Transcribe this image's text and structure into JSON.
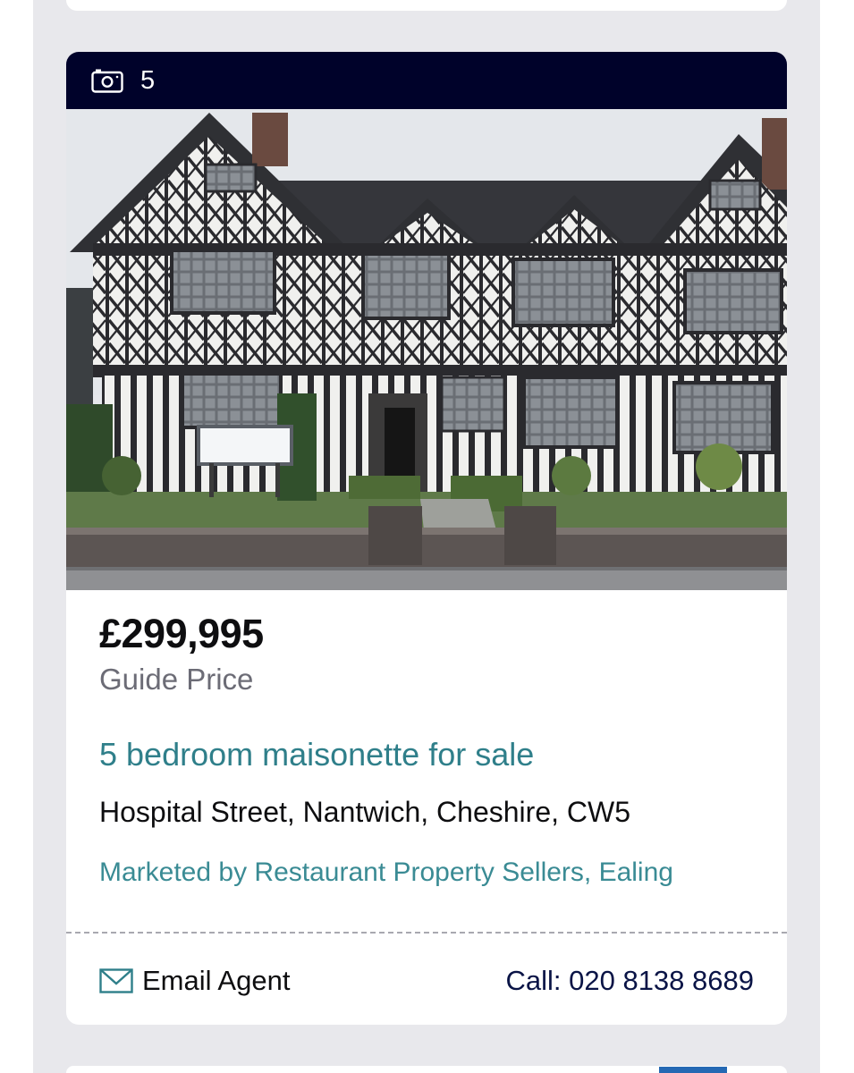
{
  "listing": {
    "photo_count": "5",
    "camera_icon": "camera-icon",
    "image_alt": "Black and white timber-framed Tudor house",
    "price": "£299,995",
    "price_qualifier": "Guide Price",
    "title": "5 bedroom maisonette for sale",
    "address": "Hospital Street, Nantwich, Cheshire, CW5",
    "marketed_by": "Marketed by Restaurant Property Sellers, Ealing",
    "email_label": "Email Agent",
    "email_icon": "envelope-icon",
    "call_label": "Call: 020 8138 8689"
  },
  "colors": {
    "photo_bar": "#00022a",
    "title": "#2f7f8a",
    "agent": "#3a8b94",
    "call": "#0a1446",
    "feed_background": "#e8e8ec",
    "next_tab": "#2568b3"
  }
}
